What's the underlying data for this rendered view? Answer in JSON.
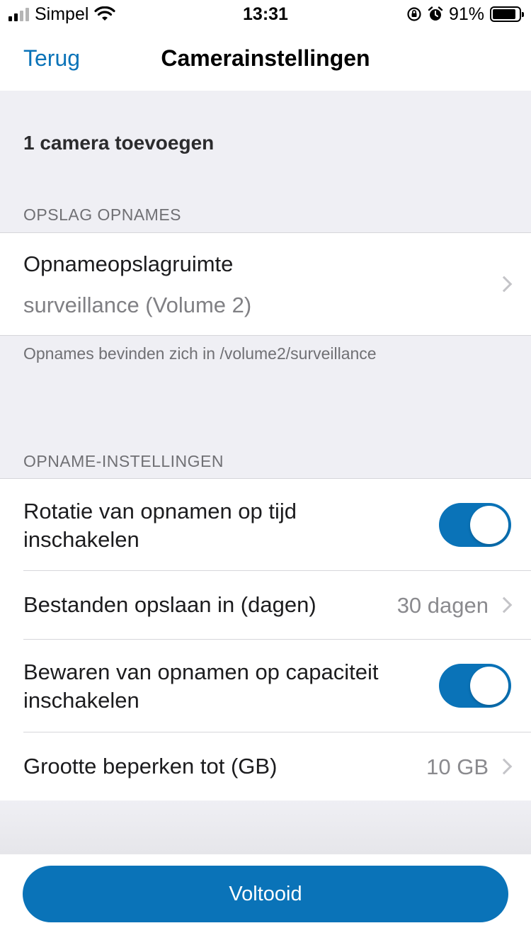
{
  "status_bar": {
    "carrier": "Simpel",
    "time": "13:31",
    "battery": "91%",
    "battery_level": 0.91,
    "icons": [
      "signal-icon",
      "wifi-icon",
      "orientation-lock-icon",
      "alarm-icon",
      "battery-icon"
    ]
  },
  "nav": {
    "back_label": "Terug",
    "title": "Camerainstellingen"
  },
  "header_text": "1 camera toevoegen",
  "storage_section": {
    "header": "OPSLAG OPNAMES",
    "row_label": "Opnameopslagruimte",
    "row_value": "surveillance (Volume 2)",
    "footnote": "Opnames bevinden zich in /volume2/surveillance"
  },
  "recording_section": {
    "header": "OPNAME-INSTELLINGEN",
    "rotation_label_line1": "Rotatie van opnamen op tijd",
    "rotation_label_line2": "inschakelen",
    "rotation_enabled": true,
    "days_label": "Bestanden opslaan in (dagen)",
    "days_value": "30 dagen",
    "capacity_label_line1": "Bewaren van opnamen op capaciteit",
    "capacity_label_line2": "inschakelen",
    "capacity_enabled": true,
    "size_label": "Grootte beperken tot (GB)",
    "size_value": "10 GB"
  },
  "footer": {
    "done_label": "Voltooid"
  },
  "colors": {
    "accent": "#0a73b8",
    "background": "#efeff4"
  }
}
